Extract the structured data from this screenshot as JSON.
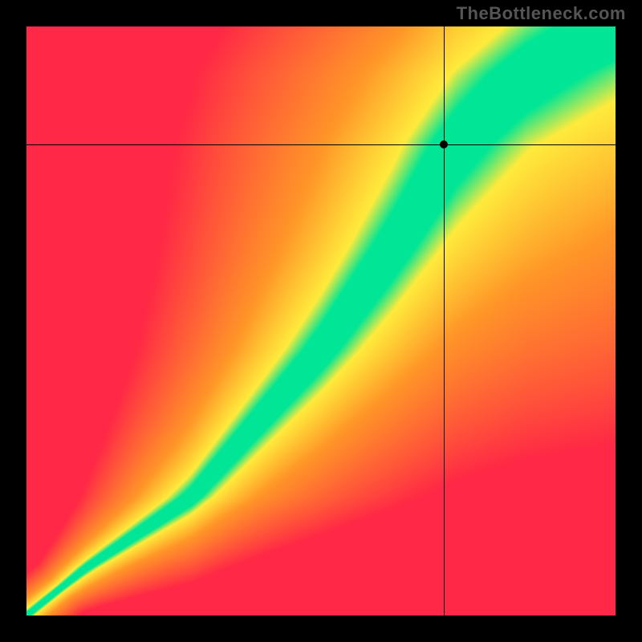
{
  "watermark": "TheBottleneck.com",
  "chart_data": {
    "type": "heatmap",
    "title": "",
    "xlabel": "",
    "ylabel": "",
    "xlim": [
      0,
      1
    ],
    "ylim": [
      0,
      1
    ],
    "colormap": "red-yellow-green (green=optimal, red=bottleneck)",
    "crosshair": {
      "x": 0.71,
      "y": 0.8
    },
    "diagonal_band": {
      "description": "curved optimal band from bottom-left to top-right",
      "anchors": [
        {
          "x": 0.0,
          "y": 0.0
        },
        {
          "x": 0.1,
          "y": 0.08
        },
        {
          "x": 0.28,
          "y": 0.2
        },
        {
          "x": 0.5,
          "y": 0.45
        },
        {
          "x": 0.62,
          "y": 0.62
        },
        {
          "x": 0.73,
          "y": 0.8
        },
        {
          "x": 0.85,
          "y": 0.92
        },
        {
          "x": 1.0,
          "y": 1.0
        }
      ],
      "width_start": 0.01,
      "width_end": 0.22
    }
  }
}
